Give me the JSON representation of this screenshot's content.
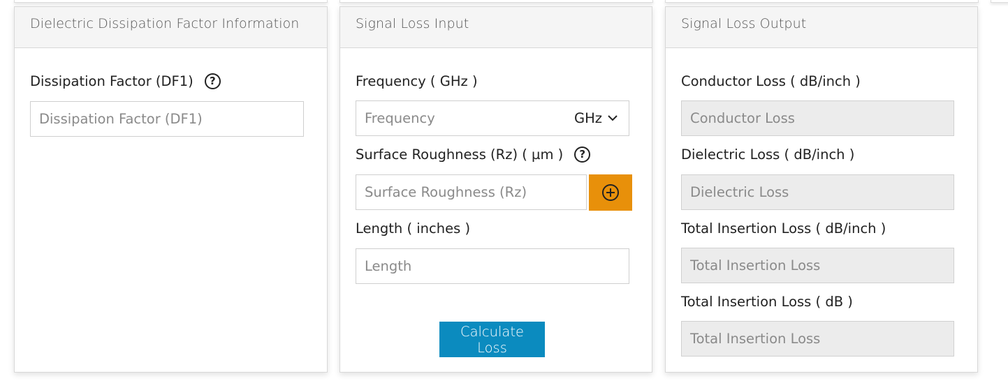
{
  "panels": {
    "dielectric": {
      "title": "Dielectric Dissipation Factor Information",
      "df_label": "Dissipation Factor (DF1)",
      "df_help": "?",
      "df_placeholder": "Dissipation Factor (DF1)"
    },
    "input": {
      "title": "Signal Loss Input",
      "frequency_label": "Frequency ( GHz )",
      "frequency_placeholder": "Frequency",
      "frequency_unit": "GHz",
      "roughness_label": "Surface Roughness (Rz) ( µm )",
      "roughness_help": "?",
      "roughness_placeholder": "Surface Roughness (Rz)",
      "length_label": "Length ( inches )",
      "length_placeholder": "Length",
      "calculate_label": "Calculate Loss"
    },
    "output": {
      "title": "Signal Loss Output",
      "conductor_label": "Conductor Loss ( dB/inch )",
      "conductor_placeholder": "Conductor Loss",
      "dielectric_label": "Dielectric Loss ( dB/inch )",
      "dielectric_placeholder": "Dielectric Loss",
      "total_per_inch_label": "Total Insertion Loss ( dB/inch )",
      "total_per_inch_placeholder": "Total Insertion Loss",
      "total_db_label": "Total Insertion Loss ( dB )",
      "total_db_placeholder": "Total Insertion Loss"
    }
  },
  "colors": {
    "accent_orange": "#e8900a",
    "button_blue": "#0b8bbf",
    "readonly_bg": "#ececec",
    "header_bg": "#f5f5f5"
  }
}
